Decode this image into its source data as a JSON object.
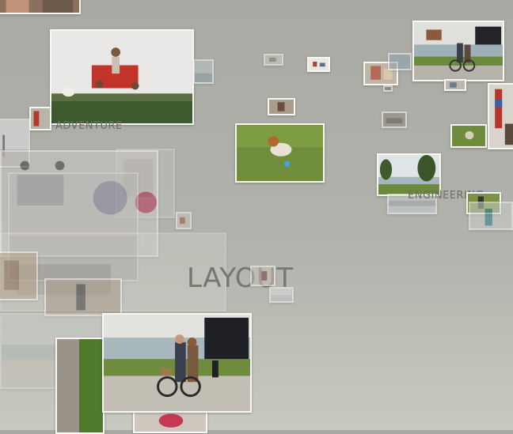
{
  "collection_labels": {
    "adventure": "ADVENTURE",
    "engineering": "ENGINEERING",
    "layout": "LAYOUT"
  },
  "photos": {
    "family_jump": "family jumping on bed",
    "dog": "dog on grass",
    "bike_couple": "couple with bicycle by water",
    "lake": "lake with trees",
    "dock": "dock and water"
  },
  "colors": {
    "background": "#abaca5",
    "frame": "#f7f7f4",
    "label": "#6c6d68"
  }
}
